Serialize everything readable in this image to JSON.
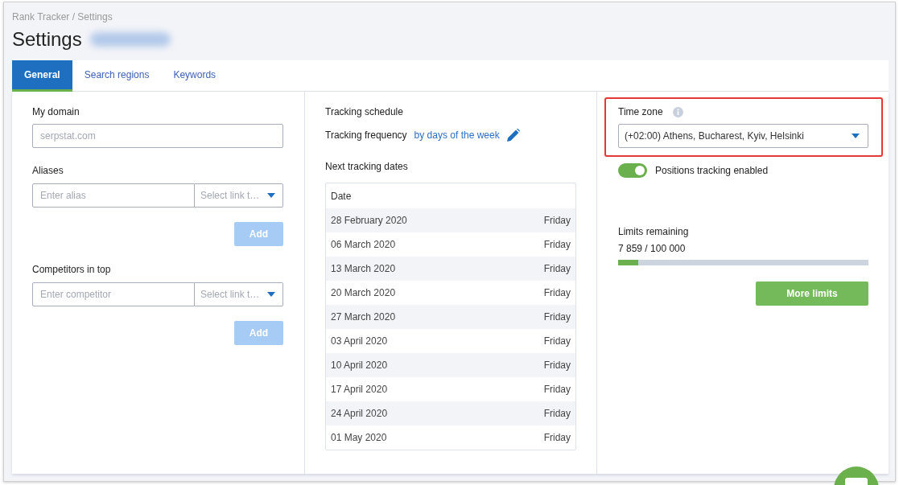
{
  "breadcrumb": "Rank Tracker / Settings",
  "page_title": "Settings",
  "tabs": [
    {
      "label": "General",
      "selected": true
    },
    {
      "label": "Search regions",
      "selected": false
    },
    {
      "label": "Keywords",
      "selected": false
    }
  ],
  "domain": {
    "label": "My domain",
    "placeholder": "serpstat.com"
  },
  "aliases": {
    "label": "Aliases",
    "placeholder": "Enter alias",
    "select_placeholder": "Select link t…",
    "button": "Add",
    "disabled": true
  },
  "competitors": {
    "label": "Competitors in top",
    "placeholder": "Enter competitor",
    "select_placeholder": "Select link t…",
    "button": "Add",
    "disabled": true
  },
  "schedule": {
    "title": "Tracking schedule",
    "frequency_label": "Tracking frequency",
    "frequency_value": "by days of the week",
    "dates_title": "Next tracking dates",
    "table": {
      "columns": [
        "Date"
      ],
      "rows": [
        [
          "28 February 2020",
          "Friday"
        ],
        [
          "06 March 2020",
          "Friday"
        ],
        [
          "13 March 2020",
          "Friday"
        ],
        [
          "20 March 2020",
          "Friday"
        ],
        [
          "27 March 2020",
          "Friday"
        ],
        [
          "03 April 2020",
          "Friday"
        ],
        [
          "10 April 2020",
          "Friday"
        ],
        [
          "17 April 2020",
          "Friday"
        ],
        [
          "24 April 2020",
          "Friday"
        ],
        [
          "01 May 2020",
          "Friday"
        ]
      ]
    }
  },
  "time_zone": {
    "label": "Time zone",
    "value": "(+02:00) Athens, Bucharest, Kyiv, Helsinki",
    "highlighted": true
  },
  "tracking_toggle": {
    "label": "Positions tracking enabled",
    "on": true
  },
  "limits": {
    "title": "Limits remaining",
    "reading": "7 859 / 100 000",
    "level": 0.079,
    "button": "More limits"
  }
}
